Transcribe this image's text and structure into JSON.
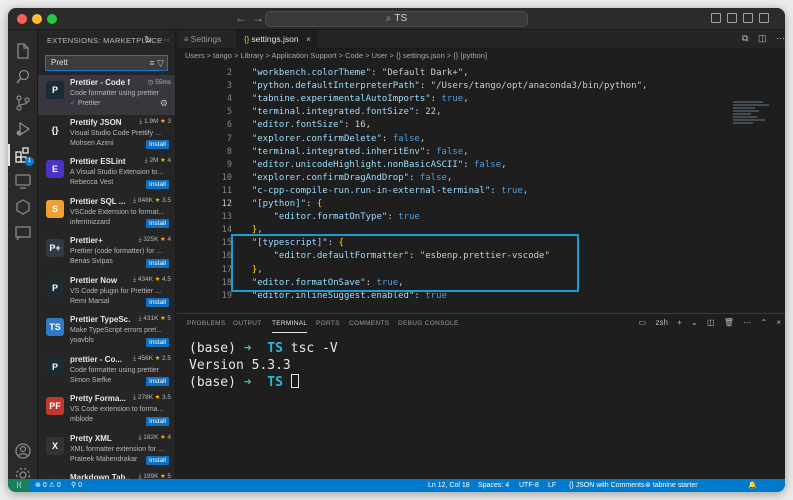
{
  "window": {
    "command_center": "TS",
    "nav_back": "←",
    "nav_forward": "→"
  },
  "activity_bar": {
    "items": [
      "explorer-icon",
      "search-icon",
      "source-control-icon",
      "run-debug-icon",
      "extensions-icon",
      "remote-explorer-icon",
      "testing-icon",
      "docker-icon",
      "chat-icon"
    ],
    "bottom": [
      "account-icon",
      "manage-gear-icon"
    ],
    "extensions_badge": "1"
  },
  "sidebar": {
    "title": "EXTENSIONS: MARKETPLACE",
    "search_value": "Prett",
    "extensions": [
      {
        "name": "Prettier - Code for...",
        "desc": "Code formatter using prettier",
        "publisher": "Prettier",
        "stats": "55ms",
        "installed": true,
        "icon_color": "#1a2b34",
        "icon_text": "P"
      },
      {
        "name": "Prettify JSON",
        "desc": "Visual Studio Code Prettify ...",
        "publisher": "Mohsen Azimi",
        "downloads": "1.9M",
        "rating": "3",
        "action": "Install",
        "icon_color": "#252526",
        "icon_text": "{}"
      },
      {
        "name": "Prettier ESLint",
        "desc": "A Visual Studio Extension to...",
        "publisher": "Rebecca Vest",
        "downloads": "2M",
        "rating": "4",
        "action": "Install",
        "icon_color": "#4b32c3",
        "icon_text": "E"
      },
      {
        "name": "Prettier SQL ...",
        "desc": "VSCode Extension to format...",
        "publisher": "inferrinizzard",
        "downloads": "848K",
        "rating": "3.5",
        "action": "Install",
        "icon_color": "#f0a030",
        "icon_text": "S"
      },
      {
        "name": "Prettier+",
        "desc": "Prettier (code formatter) for ...",
        "publisher": "Benas Svipas",
        "downloads": "325K",
        "rating": "4",
        "action": "Install",
        "icon_color": "#2f3a44",
        "icon_text": "P+"
      },
      {
        "name": "Prettier Now",
        "desc": "VS Code plugin for Prettier ...",
        "publisher": "Remi Marsal",
        "downloads": "434K",
        "rating": "4.5",
        "action": "Install",
        "icon_color": "#1a2b34",
        "icon_text": "P"
      },
      {
        "name": "Prettier TypeSc...",
        "desc": "Make TypeScript errors pret...",
        "publisher": "yoavbls",
        "downloads": "431K",
        "rating": "5",
        "action": "Install",
        "icon_color": "#3178c6",
        "icon_text": "TS"
      },
      {
        "name": "prettier - Co...",
        "desc": "Code formatter using prettier",
        "publisher": "Simon Siefke",
        "downloads": "456K",
        "rating": "2.5",
        "action": "Install",
        "icon_color": "#1a2b34",
        "icon_text": "P"
      },
      {
        "name": "Pretty Forma...",
        "desc": "VS Code extension to forma...",
        "publisher": "mblode",
        "downloads": "278K",
        "rating": "3.5",
        "action": "Install",
        "icon_color": "#c0392b",
        "icon_text": "PF"
      },
      {
        "name": "Pretty XML",
        "desc": "XML formatter extension for ...",
        "publisher": "Prateek Mahendrakar",
        "downloads": "182K",
        "rating": "4",
        "action": "Install",
        "icon_color": "#333333",
        "icon_text": "X"
      },
      {
        "name": "Markdown Tab...",
        "desc": "",
        "publisher": "",
        "downloads": "199K",
        "rating": "5",
        "action": "",
        "icon_color": "#2a2a2a",
        "icon_text": "M"
      }
    ]
  },
  "editor": {
    "tabs": [
      {
        "label": "Settings",
        "active": false
      },
      {
        "label": "settings.json",
        "active": true
      }
    ],
    "breadcrumb": "Users > tango > Library > Application Support > Code > User > {} settings.json > {} [python]",
    "lines": [
      {
        "n": "2",
        "text": "  \"workbench.colorTheme\": \"Default Dark+\","
      },
      {
        "n": "3",
        "text": "  \"python.defaultInterpreterPath\": \"/Users/tango/opt/anaconda3/bin/python\","
      },
      {
        "n": "4",
        "text": "  \"tabnine.experimentalAutoImports\": true,"
      },
      {
        "n": "5",
        "text": "  \"terminal.integrated.fontSize\": 22,"
      },
      {
        "n": "6",
        "text": "  \"editor.fontSize\": 16,"
      },
      {
        "n": "7",
        "text": "  \"explorer.confirmDelete\": false,"
      },
      {
        "n": "8",
        "text": "  \"terminal.integrated.inheritEnv\": false,"
      },
      {
        "n": "9",
        "text": "  \"editor.unicodeHighlight.nonBasicASCII\": false,"
      },
      {
        "n": "10",
        "text": "  \"explorer.confirmDragAndDrop\": false,"
      },
      {
        "n": "11",
        "text": "  \"c-cpp-compile-run.run-in-external-terminal\": true,"
      },
      {
        "n": "12",
        "text": "  \"[python]\": {"
      },
      {
        "n": "13",
        "text": "      \"editor.formatOnType\": true"
      },
      {
        "n": "14",
        "text": "  },"
      },
      {
        "n": "15",
        "text": "  \"[typescript]\": {"
      },
      {
        "n": "16",
        "text": "      \"editor.defaultFormatter\": \"esbenp.prettier-vscode\""
      },
      {
        "n": "17",
        "text": "  },"
      },
      {
        "n": "18",
        "text": "  \"editor.formatOnSave\": true,"
      },
      {
        "n": "19",
        "text": "  \"editor.inlineSuggest.enabled\": true"
      }
    ]
  },
  "panel": {
    "tabs": [
      "PROBLEMS",
      "OUTPUT",
      "TERMINAL",
      "PORTS",
      "COMMENTS",
      "DEBUG CONSOLE"
    ],
    "active_tab": "TERMINAL",
    "shell": "zsh",
    "terminal": {
      "env": "(base)",
      "arrow": "➜",
      "dir": "TS",
      "command": "tsc -V",
      "output": "Version 5.3.3"
    }
  },
  "statusbar": {
    "errors": "0",
    "warnings": "0",
    "info": "0",
    "position": "Ln 12, Col 18",
    "spaces": "Spaces: 4",
    "encoding": "UTF-8",
    "eol": "LF",
    "language": "JSON with Comments",
    "tabnine": "tabnine starter"
  }
}
